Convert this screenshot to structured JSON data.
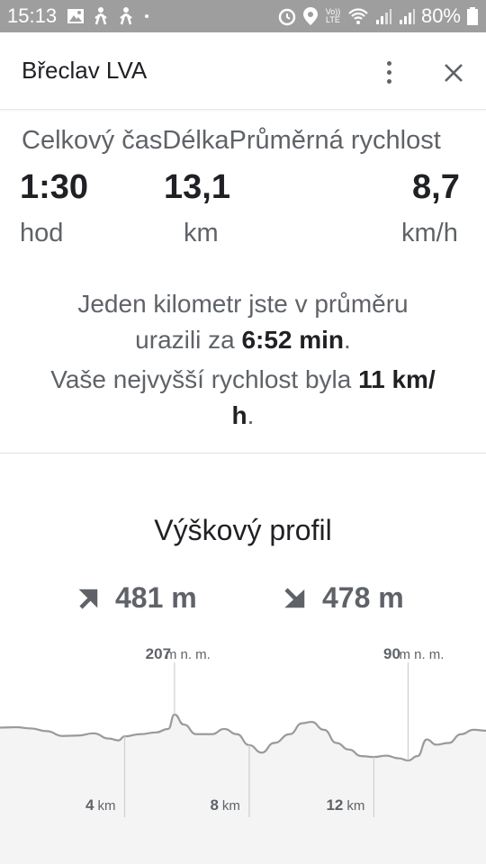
{
  "status_bar": {
    "time": "15:13",
    "battery": "80%",
    "volte": "Vo)) LTE"
  },
  "header": {
    "title": "Břeclav LVA"
  },
  "stats": {
    "labels": [
      "Celkový čas",
      "Délka",
      "Průměrná rychlost"
    ],
    "time_value": "1:30",
    "time_unit": "hod",
    "distance_value": "13,1",
    "distance_unit": "km",
    "speed_value": "8,7",
    "speed_unit": "km/h"
  },
  "summary": {
    "pace_prefix": "Jeden kilometr jste v průměru",
    "pace_line2_prefix": "urazili za ",
    "pace_value": "6:52 min",
    "pace_suffix": ".",
    "top_prefix": "Vaše nejvyšší rychlost byla ",
    "top_value_line1": "11 km/",
    "top_value_line2": "h",
    "top_suffix": "."
  },
  "elevation": {
    "title": "Výškový profil",
    "ascent": "481 m",
    "descent": "478 m"
  },
  "chart_data": {
    "type": "line",
    "title": "",
    "xlabel": "",
    "ylabel": "",
    "x_unit": "km",
    "y_unit": "m n. m.",
    "x_ticks": [
      {
        "value": 4,
        "label": "4"
      },
      {
        "value": 8,
        "label": "8"
      },
      {
        "value": 12,
        "label": "12"
      }
    ],
    "annotations": [
      {
        "x": 5.6,
        "label": "207",
        "unit": "m n. m."
      },
      {
        "x": 13.1,
        "label": "90",
        "unit": "m n. m."
      }
    ],
    "xlim": [
      0,
      15.6
    ],
    "ylim": [
      90,
      207
    ],
    "series": [
      {
        "x": [
          0,
          0.5,
          1.0,
          1.5,
          2.0,
          2.5,
          3.0,
          3.5,
          3.8,
          4.0,
          4.5,
          5.0,
          5.4,
          5.6,
          5.9,
          6.3,
          6.8,
          7.2,
          7.6,
          8.0,
          8.4,
          8.8,
          9.3,
          9.7,
          10.0,
          10.4,
          10.8,
          11.2,
          11.6,
          12.0,
          12.4,
          12.8,
          13.1,
          13.4,
          13.7,
          14.0,
          14.4,
          14.8,
          15.2,
          15.6
        ],
        "values": [
          165,
          166,
          163,
          157,
          146,
          147,
          152,
          140,
          136,
          145,
          150,
          154,
          162,
          195,
          172,
          150,
          150,
          162,
          150,
          125,
          108,
          130,
          150,
          175,
          178,
          160,
          130,
          115,
          100,
          98,
          101,
          95,
          90,
          100,
          138,
          126,
          130,
          150,
          160,
          158
        ]
      }
    ]
  }
}
